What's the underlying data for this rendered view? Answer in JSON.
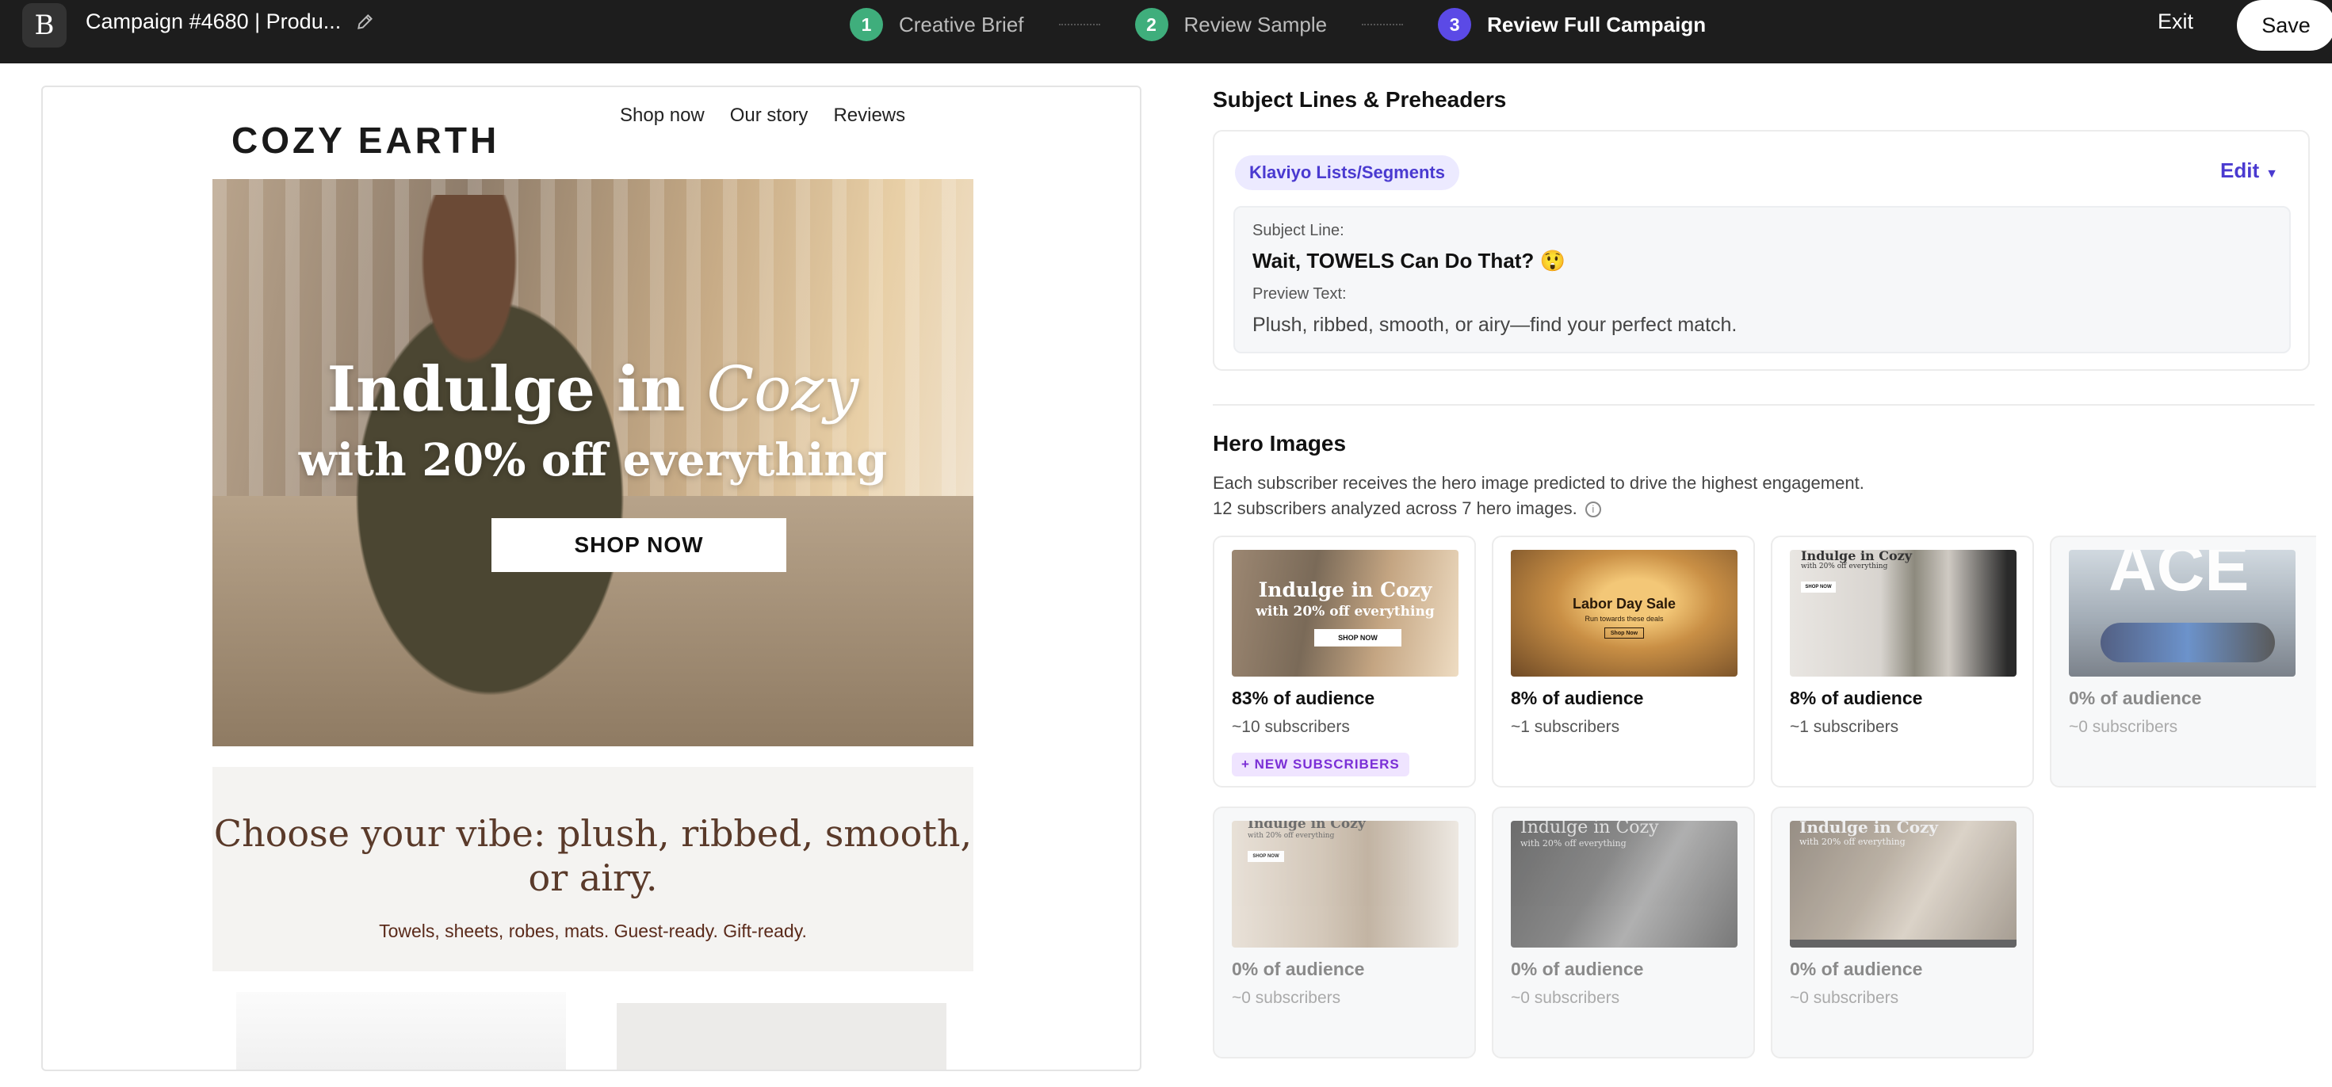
{
  "topbar": {
    "logo_text": "B",
    "campaign_title": "Campaign #4680 | Produ...",
    "steps": [
      {
        "num": "1",
        "label": "Creative Brief"
      },
      {
        "num": "2",
        "label": "Review Sample"
      },
      {
        "num": "3",
        "label": "Review Full Campaign"
      }
    ],
    "exit_label": "Exit",
    "save_label": "Save"
  },
  "email": {
    "brand": "COZY EARTH",
    "nav": [
      "Shop now",
      "Our story",
      "Reviews"
    ],
    "hero_line1_a": "Indulge in ",
    "hero_line1_b": "Cozy",
    "hero_line2": "with 20% off everything",
    "hero_cta": "SHOP NOW",
    "vibe_heading": "Choose your vibe: plush, ribbed, smooth, or airy.",
    "vibe_sub": "Towels, sheets, robes, mats. Guest-ready. Gift-ready."
  },
  "subject": {
    "section_title": "Subject Lines & Preheaders",
    "segment_badge": "Klaviyo Lists/Segments",
    "edit_label": "Edit",
    "subject_label": "Subject Line:",
    "subject_value": "Wait, TOWELS Can Do That? 😲",
    "preview_label": "Preview Text:",
    "preview_value": "Plush, ribbed, smooth, or airy—find your perfect match."
  },
  "hero_images": {
    "section_title": "Hero Images",
    "desc_line1": "Each subscriber receives the hero image predicted to drive the highest engagement.",
    "desc_line2": "12 subscribers analyzed across 7 hero images.",
    "cards": [
      {
        "pct": "83% of audience",
        "subs": "~10 subscribers",
        "badge": "+ NEW SUBSCRIBERS",
        "t1": "Indulge in Cozy",
        "t2": "with 20% off everything",
        "btn": "SHOP NOW"
      },
      {
        "pct": "8% of audience",
        "subs": "~1 subscribers",
        "t1": "Labor Day Sale",
        "t2": "Run towards these deals",
        "btn": "Shop Now"
      },
      {
        "pct": "8% of audience",
        "subs": "~1 subscribers",
        "t1": "Indulge in Cozy",
        "t2": "with 20% off everything",
        "btn": "SHOP NOW"
      },
      {
        "pct": "0% of audience",
        "subs": "~0 subscribers",
        "t1": "ACE"
      },
      {
        "pct": "0% of audience",
        "subs": "~0 subscribers",
        "t1": "Indulge in Cozy",
        "t2": "with 20% off everything",
        "btn": "SHOP NOW"
      },
      {
        "pct": "0% of audience",
        "subs": "~0 subscribers",
        "t1": "Indulge in Cozy",
        "t2": "with 20% off everything"
      },
      {
        "pct": "0% of audience",
        "subs": "~0 subscribers",
        "t1": "Indulge in Cozy",
        "t2": "with 20% off everything"
      }
    ]
  }
}
